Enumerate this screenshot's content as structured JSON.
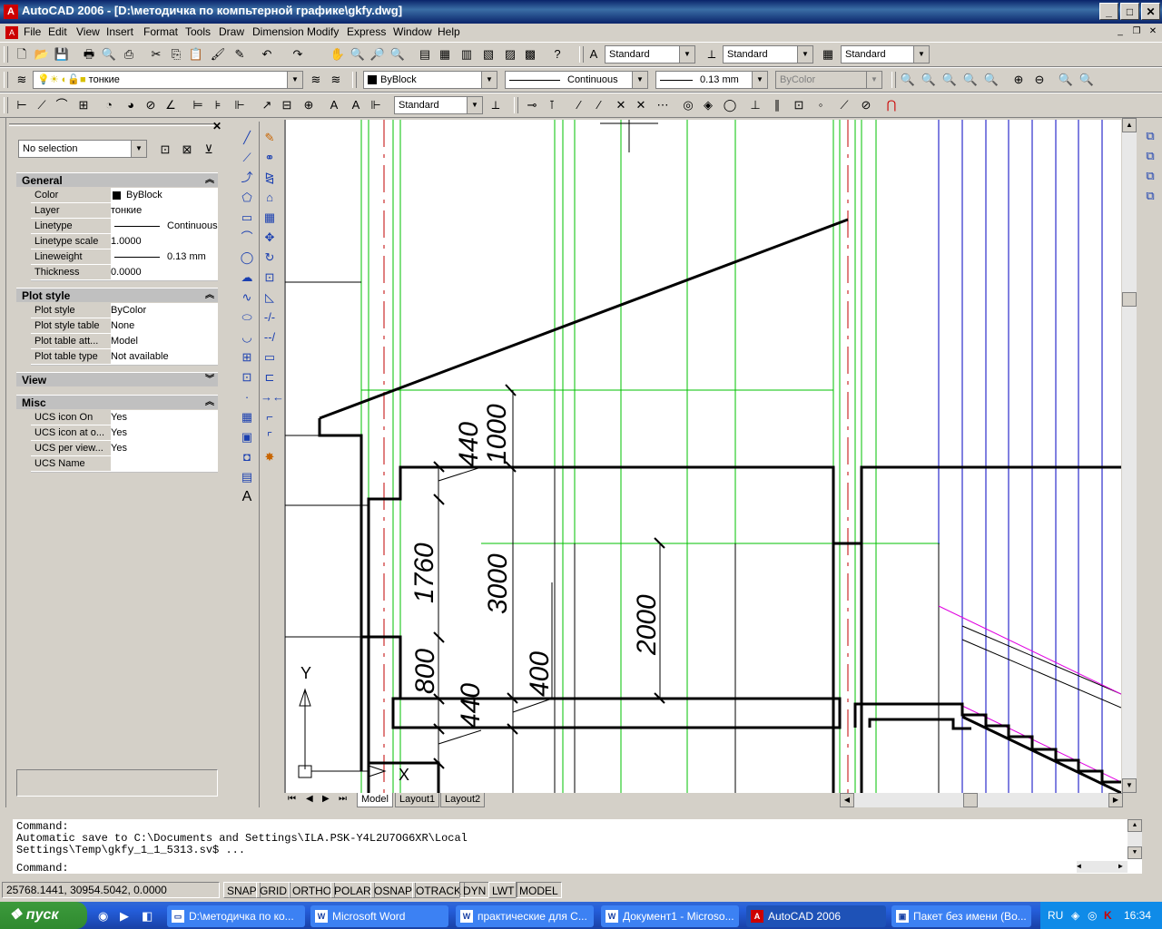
{
  "window": {
    "title": "AutoCAD 2006 - [D:\\методичка по компьтерной графике\\gkfy.dwg]",
    "app_icon": "autocad-icon"
  },
  "menu": [
    "File",
    "Edit",
    "View",
    "Insert",
    "Format",
    "Tools",
    "Draw",
    "Dimension",
    "Modify",
    "Express",
    "Window",
    "Help"
  ],
  "styles": {
    "text_style": "Standard",
    "dim_style": "Standard",
    "table_style": "Standard"
  },
  "layers": {
    "current_layer": "тонкие"
  },
  "properties_bar": {
    "color": "ByBlock",
    "linetype": "Continuous",
    "lineweight": "0.13 mm",
    "plot_style": "ByColor"
  },
  "dim_toolbar": {
    "dim_style": "Standard"
  },
  "palette": {
    "selection": "No selection",
    "general": {
      "title": "General",
      "rows": [
        {
          "label": "Color",
          "value": "ByBlock"
        },
        {
          "label": "Layer",
          "value": "тонкие"
        },
        {
          "label": "Linetype",
          "value": "Continuous"
        },
        {
          "label": "Linetype scale",
          "value": "1.0000"
        },
        {
          "label": "Lineweight",
          "value": "0.13 mm"
        },
        {
          "label": "Thickness",
          "value": "0.0000"
        }
      ]
    },
    "plot_style": {
      "title": "Plot style",
      "rows": [
        {
          "label": "Plot style",
          "value": "ByColor"
        },
        {
          "label": "Plot style table",
          "value": "None"
        },
        {
          "label": "Plot table att...",
          "value": "Model"
        },
        {
          "label": "Plot table type",
          "value": "Not available"
        }
      ]
    },
    "view": {
      "title": "View"
    },
    "misc": {
      "title": "Misc",
      "rows": [
        {
          "label": "UCS icon On",
          "value": "Yes"
        },
        {
          "label": "UCS icon at o...",
          "value": "Yes"
        },
        {
          "label": "UCS per view...",
          "value": "Yes"
        },
        {
          "label": "UCS Name",
          "value": ""
        }
      ]
    }
  },
  "drawing": {
    "dimensions": [
      "1000",
      "440",
      "1760",
      "3000",
      "2000",
      "800",
      "440",
      "400"
    ],
    "ucs": {
      "y": "Y",
      "x": "X"
    }
  },
  "tabs": [
    "Model",
    "Layout1",
    "Layout2"
  ],
  "command": {
    "lines": [
      "Command:",
      "Automatic save to C:\\Documents and Settings\\ILA.PSK-Y4L2U7OG6XR\\Local",
      "Settings\\Temp\\gkfy_1_1_5313.sv$ ..."
    ],
    "prompt": "Command:"
  },
  "status": {
    "coords": "25768.1441, 30954.5042, 0.0000",
    "buttons": [
      "SNAP",
      "GRID",
      "ORTHO",
      "POLAR",
      "OSNAP",
      "OTRACK",
      "DYN",
      "LWT",
      "MODEL"
    ]
  },
  "taskbar": {
    "start": "пуск",
    "tasks": [
      "D:\\методичка по ко...",
      "Microsoft Word",
      "практические для С...",
      "Документ1 - Microso...",
      "AutoCAD 2006",
      "Пакет без имени (Во..."
    ],
    "lang": "RU",
    "time": "16:34"
  }
}
